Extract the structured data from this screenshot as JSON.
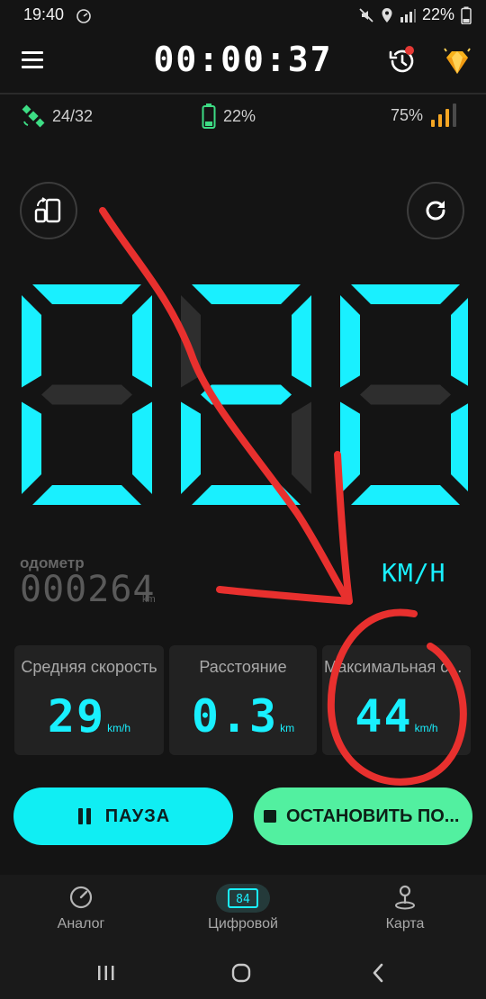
{
  "status_bar": {
    "time": "19:40",
    "battery_pct": "22%"
  },
  "header": {
    "timer": "00:00:37"
  },
  "info": {
    "satellites": "24/32",
    "battery": "22%",
    "signal": "75%"
  },
  "speed": {
    "digits": [
      "0",
      "2",
      "0"
    ],
    "unit": "KM/H"
  },
  "odometer": {
    "label": "одометр",
    "value": "000264",
    "unit": "km"
  },
  "stats": [
    {
      "title": "Средняя скорость",
      "value": "29",
      "unit": "km/h"
    },
    {
      "title": "Расстояние",
      "value": "0.3",
      "unit": "km"
    },
    {
      "title": "Максимальная с...",
      "value": "44",
      "unit": "km/h"
    }
  ],
  "actions": {
    "pause_label": "ПАУЗА",
    "stop_label": "ОСТАНОВИТЬ ПО..."
  },
  "nav": {
    "items": [
      {
        "label": "Аналог",
        "icon": "speedometer-icon"
      },
      {
        "label": "Цифровой",
        "icon": "digital-speed-icon",
        "badge": "84"
      },
      {
        "label": "Карта",
        "icon": "map-pin-icon"
      }
    ]
  },
  "colors": {
    "accent": "#19f0ff",
    "pause_bg": "#10eef3",
    "stop_bg": "#52f0a0",
    "annotation": "#e8302e"
  }
}
